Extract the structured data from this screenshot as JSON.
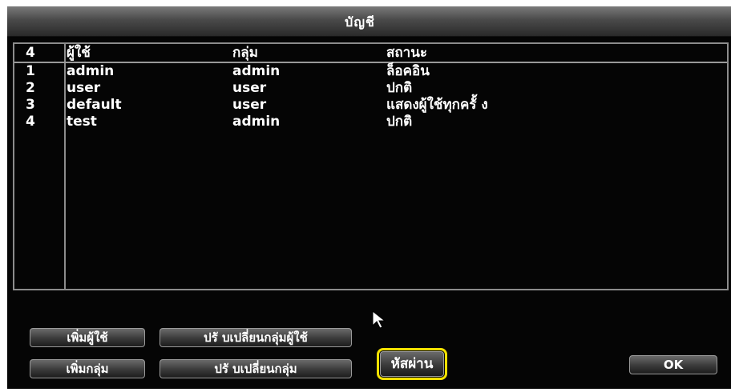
{
  "window": {
    "title": "บัญชี"
  },
  "table": {
    "headers": {
      "count": "4",
      "user": "ผู้ใช้",
      "group": "กลุ่ม",
      "status": "สถานะ"
    },
    "rows": [
      {
        "num": "1",
        "user": "admin",
        "group": "admin",
        "status": "ล็อคอิน"
      },
      {
        "num": "2",
        "user": "user",
        "group": "user",
        "status": "ปกติ"
      },
      {
        "num": "3",
        "user": "default",
        "group": "user",
        "status": "แสดงผู้ใช้ทุกครั้ ง"
      },
      {
        "num": "4",
        "user": "test",
        "group": "admin",
        "status": "ปกติ"
      }
    ]
  },
  "buttons": {
    "add_user": "เพิ่มผู้ใช้",
    "modify_user": "ปรั บเปลี่ยนกลุ่มผู้ใช้",
    "add_group": "เพิ่มกลุ่ม",
    "modify_group": "ปรั บเปลี่ยนกลุ่ม",
    "password": "หัสผ่าน",
    "ok": "OK"
  },
  "colors": {
    "highlight": "#f3e100",
    "background": "#050505"
  }
}
